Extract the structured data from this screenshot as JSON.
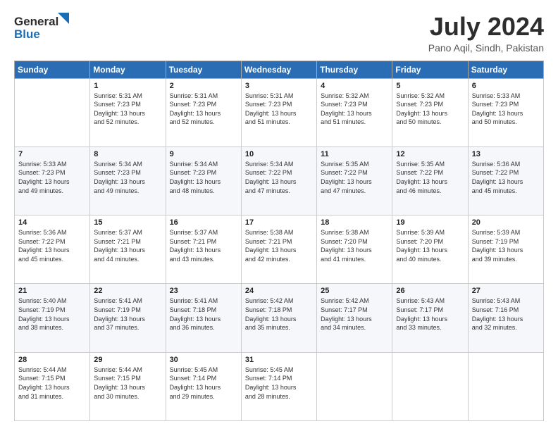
{
  "header": {
    "logo_line1": "General",
    "logo_line2": "Blue",
    "month": "July 2024",
    "location": "Pano Aqil, Sindh, Pakistan"
  },
  "weekdays": [
    "Sunday",
    "Monday",
    "Tuesday",
    "Wednesday",
    "Thursday",
    "Friday",
    "Saturday"
  ],
  "weeks": [
    [
      {
        "day": "",
        "info": ""
      },
      {
        "day": "1",
        "info": "Sunrise: 5:31 AM\nSunset: 7:23 PM\nDaylight: 13 hours\nand 52 minutes."
      },
      {
        "day": "2",
        "info": "Sunrise: 5:31 AM\nSunset: 7:23 PM\nDaylight: 13 hours\nand 52 minutes."
      },
      {
        "day": "3",
        "info": "Sunrise: 5:31 AM\nSunset: 7:23 PM\nDaylight: 13 hours\nand 51 minutes."
      },
      {
        "day": "4",
        "info": "Sunrise: 5:32 AM\nSunset: 7:23 PM\nDaylight: 13 hours\nand 51 minutes."
      },
      {
        "day": "5",
        "info": "Sunrise: 5:32 AM\nSunset: 7:23 PM\nDaylight: 13 hours\nand 50 minutes."
      },
      {
        "day": "6",
        "info": "Sunrise: 5:33 AM\nSunset: 7:23 PM\nDaylight: 13 hours\nand 50 minutes."
      }
    ],
    [
      {
        "day": "7",
        "info": "Sunrise: 5:33 AM\nSunset: 7:23 PM\nDaylight: 13 hours\nand 49 minutes."
      },
      {
        "day": "8",
        "info": "Sunrise: 5:34 AM\nSunset: 7:23 PM\nDaylight: 13 hours\nand 49 minutes."
      },
      {
        "day": "9",
        "info": "Sunrise: 5:34 AM\nSunset: 7:23 PM\nDaylight: 13 hours\nand 48 minutes."
      },
      {
        "day": "10",
        "info": "Sunrise: 5:34 AM\nSunset: 7:22 PM\nDaylight: 13 hours\nand 47 minutes."
      },
      {
        "day": "11",
        "info": "Sunrise: 5:35 AM\nSunset: 7:22 PM\nDaylight: 13 hours\nand 47 minutes."
      },
      {
        "day": "12",
        "info": "Sunrise: 5:35 AM\nSunset: 7:22 PM\nDaylight: 13 hours\nand 46 minutes."
      },
      {
        "day": "13",
        "info": "Sunrise: 5:36 AM\nSunset: 7:22 PM\nDaylight: 13 hours\nand 45 minutes."
      }
    ],
    [
      {
        "day": "14",
        "info": "Sunrise: 5:36 AM\nSunset: 7:22 PM\nDaylight: 13 hours\nand 45 minutes."
      },
      {
        "day": "15",
        "info": "Sunrise: 5:37 AM\nSunset: 7:21 PM\nDaylight: 13 hours\nand 44 minutes."
      },
      {
        "day": "16",
        "info": "Sunrise: 5:37 AM\nSunset: 7:21 PM\nDaylight: 13 hours\nand 43 minutes."
      },
      {
        "day": "17",
        "info": "Sunrise: 5:38 AM\nSunset: 7:21 PM\nDaylight: 13 hours\nand 42 minutes."
      },
      {
        "day": "18",
        "info": "Sunrise: 5:38 AM\nSunset: 7:20 PM\nDaylight: 13 hours\nand 41 minutes."
      },
      {
        "day": "19",
        "info": "Sunrise: 5:39 AM\nSunset: 7:20 PM\nDaylight: 13 hours\nand 40 minutes."
      },
      {
        "day": "20",
        "info": "Sunrise: 5:39 AM\nSunset: 7:19 PM\nDaylight: 13 hours\nand 39 minutes."
      }
    ],
    [
      {
        "day": "21",
        "info": "Sunrise: 5:40 AM\nSunset: 7:19 PM\nDaylight: 13 hours\nand 38 minutes."
      },
      {
        "day": "22",
        "info": "Sunrise: 5:41 AM\nSunset: 7:19 PM\nDaylight: 13 hours\nand 37 minutes."
      },
      {
        "day": "23",
        "info": "Sunrise: 5:41 AM\nSunset: 7:18 PM\nDaylight: 13 hours\nand 36 minutes."
      },
      {
        "day": "24",
        "info": "Sunrise: 5:42 AM\nSunset: 7:18 PM\nDaylight: 13 hours\nand 35 minutes."
      },
      {
        "day": "25",
        "info": "Sunrise: 5:42 AM\nSunset: 7:17 PM\nDaylight: 13 hours\nand 34 minutes."
      },
      {
        "day": "26",
        "info": "Sunrise: 5:43 AM\nSunset: 7:17 PM\nDaylight: 13 hours\nand 33 minutes."
      },
      {
        "day": "27",
        "info": "Sunrise: 5:43 AM\nSunset: 7:16 PM\nDaylight: 13 hours\nand 32 minutes."
      }
    ],
    [
      {
        "day": "28",
        "info": "Sunrise: 5:44 AM\nSunset: 7:15 PM\nDaylight: 13 hours\nand 31 minutes."
      },
      {
        "day": "29",
        "info": "Sunrise: 5:44 AM\nSunset: 7:15 PM\nDaylight: 13 hours\nand 30 minutes."
      },
      {
        "day": "30",
        "info": "Sunrise: 5:45 AM\nSunset: 7:14 PM\nDaylight: 13 hours\nand 29 minutes."
      },
      {
        "day": "31",
        "info": "Sunrise: 5:45 AM\nSunset: 7:14 PM\nDaylight: 13 hours\nand 28 minutes."
      },
      {
        "day": "",
        "info": ""
      },
      {
        "day": "",
        "info": ""
      },
      {
        "day": "",
        "info": ""
      }
    ]
  ]
}
